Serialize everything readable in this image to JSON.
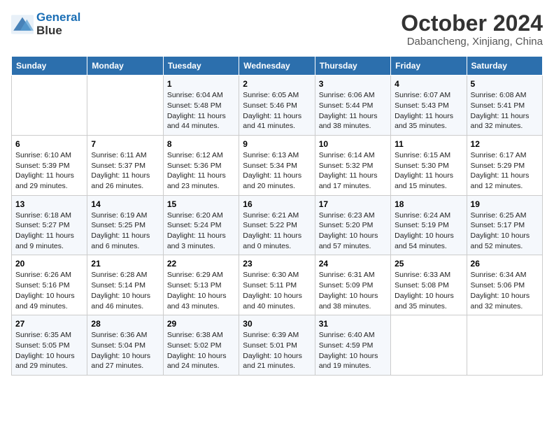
{
  "header": {
    "logo_line1": "General",
    "logo_line2": "Blue",
    "month_year": "October 2024",
    "location": "Dabancheng, Xinjiang, China"
  },
  "weekdays": [
    "Sunday",
    "Monday",
    "Tuesday",
    "Wednesday",
    "Thursday",
    "Friday",
    "Saturday"
  ],
  "weeks": [
    [
      {
        "day": "",
        "sunrise": "",
        "sunset": "",
        "daylight": ""
      },
      {
        "day": "",
        "sunrise": "",
        "sunset": "",
        "daylight": ""
      },
      {
        "day": "1",
        "sunrise": "Sunrise: 6:04 AM",
        "sunset": "Sunset: 5:48 PM",
        "daylight": "Daylight: 11 hours and 44 minutes."
      },
      {
        "day": "2",
        "sunrise": "Sunrise: 6:05 AM",
        "sunset": "Sunset: 5:46 PM",
        "daylight": "Daylight: 11 hours and 41 minutes."
      },
      {
        "day": "3",
        "sunrise": "Sunrise: 6:06 AM",
        "sunset": "Sunset: 5:44 PM",
        "daylight": "Daylight: 11 hours and 38 minutes."
      },
      {
        "day": "4",
        "sunrise": "Sunrise: 6:07 AM",
        "sunset": "Sunset: 5:43 PM",
        "daylight": "Daylight: 11 hours and 35 minutes."
      },
      {
        "day": "5",
        "sunrise": "Sunrise: 6:08 AM",
        "sunset": "Sunset: 5:41 PM",
        "daylight": "Daylight: 11 hours and 32 minutes."
      }
    ],
    [
      {
        "day": "6",
        "sunrise": "Sunrise: 6:10 AM",
        "sunset": "Sunset: 5:39 PM",
        "daylight": "Daylight: 11 hours and 29 minutes."
      },
      {
        "day": "7",
        "sunrise": "Sunrise: 6:11 AM",
        "sunset": "Sunset: 5:37 PM",
        "daylight": "Daylight: 11 hours and 26 minutes."
      },
      {
        "day": "8",
        "sunrise": "Sunrise: 6:12 AM",
        "sunset": "Sunset: 5:36 PM",
        "daylight": "Daylight: 11 hours and 23 minutes."
      },
      {
        "day": "9",
        "sunrise": "Sunrise: 6:13 AM",
        "sunset": "Sunset: 5:34 PM",
        "daylight": "Daylight: 11 hours and 20 minutes."
      },
      {
        "day": "10",
        "sunrise": "Sunrise: 6:14 AM",
        "sunset": "Sunset: 5:32 PM",
        "daylight": "Daylight: 11 hours and 17 minutes."
      },
      {
        "day": "11",
        "sunrise": "Sunrise: 6:15 AM",
        "sunset": "Sunset: 5:30 PM",
        "daylight": "Daylight: 11 hours and 15 minutes."
      },
      {
        "day": "12",
        "sunrise": "Sunrise: 6:17 AM",
        "sunset": "Sunset: 5:29 PM",
        "daylight": "Daylight: 11 hours and 12 minutes."
      }
    ],
    [
      {
        "day": "13",
        "sunrise": "Sunrise: 6:18 AM",
        "sunset": "Sunset: 5:27 PM",
        "daylight": "Daylight: 11 hours and 9 minutes."
      },
      {
        "day": "14",
        "sunrise": "Sunrise: 6:19 AM",
        "sunset": "Sunset: 5:25 PM",
        "daylight": "Daylight: 11 hours and 6 minutes."
      },
      {
        "day": "15",
        "sunrise": "Sunrise: 6:20 AM",
        "sunset": "Sunset: 5:24 PM",
        "daylight": "Daylight: 11 hours and 3 minutes."
      },
      {
        "day": "16",
        "sunrise": "Sunrise: 6:21 AM",
        "sunset": "Sunset: 5:22 PM",
        "daylight": "Daylight: 11 hours and 0 minutes."
      },
      {
        "day": "17",
        "sunrise": "Sunrise: 6:23 AM",
        "sunset": "Sunset: 5:20 PM",
        "daylight": "Daylight: 10 hours and 57 minutes."
      },
      {
        "day": "18",
        "sunrise": "Sunrise: 6:24 AM",
        "sunset": "Sunset: 5:19 PM",
        "daylight": "Daylight: 10 hours and 54 minutes."
      },
      {
        "day": "19",
        "sunrise": "Sunrise: 6:25 AM",
        "sunset": "Sunset: 5:17 PM",
        "daylight": "Daylight: 10 hours and 52 minutes."
      }
    ],
    [
      {
        "day": "20",
        "sunrise": "Sunrise: 6:26 AM",
        "sunset": "Sunset: 5:16 PM",
        "daylight": "Daylight: 10 hours and 49 minutes."
      },
      {
        "day": "21",
        "sunrise": "Sunrise: 6:28 AM",
        "sunset": "Sunset: 5:14 PM",
        "daylight": "Daylight: 10 hours and 46 minutes."
      },
      {
        "day": "22",
        "sunrise": "Sunrise: 6:29 AM",
        "sunset": "Sunset: 5:13 PM",
        "daylight": "Daylight: 10 hours and 43 minutes."
      },
      {
        "day": "23",
        "sunrise": "Sunrise: 6:30 AM",
        "sunset": "Sunset: 5:11 PM",
        "daylight": "Daylight: 10 hours and 40 minutes."
      },
      {
        "day": "24",
        "sunrise": "Sunrise: 6:31 AM",
        "sunset": "Sunset: 5:09 PM",
        "daylight": "Daylight: 10 hours and 38 minutes."
      },
      {
        "day": "25",
        "sunrise": "Sunrise: 6:33 AM",
        "sunset": "Sunset: 5:08 PM",
        "daylight": "Daylight: 10 hours and 35 minutes."
      },
      {
        "day": "26",
        "sunrise": "Sunrise: 6:34 AM",
        "sunset": "Sunset: 5:06 PM",
        "daylight": "Daylight: 10 hours and 32 minutes."
      }
    ],
    [
      {
        "day": "27",
        "sunrise": "Sunrise: 6:35 AM",
        "sunset": "Sunset: 5:05 PM",
        "daylight": "Daylight: 10 hours and 29 minutes."
      },
      {
        "day": "28",
        "sunrise": "Sunrise: 6:36 AM",
        "sunset": "Sunset: 5:04 PM",
        "daylight": "Daylight: 10 hours and 27 minutes."
      },
      {
        "day": "29",
        "sunrise": "Sunrise: 6:38 AM",
        "sunset": "Sunset: 5:02 PM",
        "daylight": "Daylight: 10 hours and 24 minutes."
      },
      {
        "day": "30",
        "sunrise": "Sunrise: 6:39 AM",
        "sunset": "Sunset: 5:01 PM",
        "daylight": "Daylight: 10 hours and 21 minutes."
      },
      {
        "day": "31",
        "sunrise": "Sunrise: 6:40 AM",
        "sunset": "Sunset: 4:59 PM",
        "daylight": "Daylight: 10 hours and 19 minutes."
      },
      {
        "day": "",
        "sunrise": "",
        "sunset": "",
        "daylight": ""
      },
      {
        "day": "",
        "sunrise": "",
        "sunset": "",
        "daylight": ""
      }
    ]
  ]
}
